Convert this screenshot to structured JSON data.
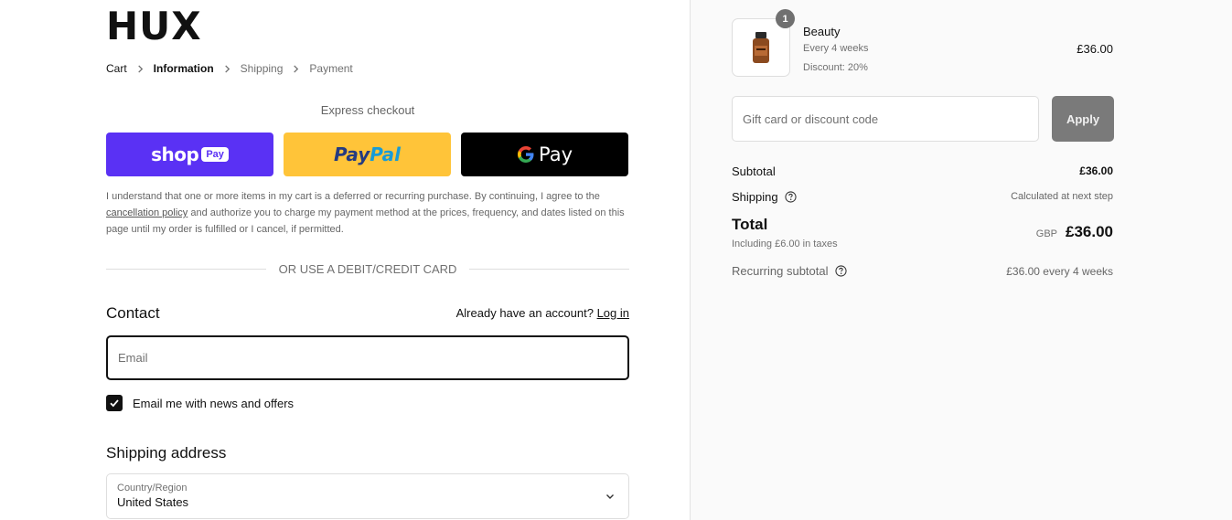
{
  "brand": {
    "logo_text": "HUX"
  },
  "breadcrumb": [
    {
      "label": "Cart",
      "state": "link"
    },
    {
      "label": "Information",
      "state": "current"
    },
    {
      "label": "Shipping",
      "state": "pending"
    },
    {
      "label": "Payment",
      "state": "pending"
    }
  ],
  "express": {
    "title": "Express checkout",
    "shop_word": "shop",
    "shop_pay": "Pay",
    "paypal_part1": "Pay",
    "paypal_part2": "Pal",
    "gpay_word": "Pay"
  },
  "disclaimer": {
    "before": "I understand that one or more items in my cart is a deferred or recurring purchase. By continuing, I agree to the ",
    "link": "cancellation policy",
    "after": " and authorize you to charge my payment method at the prices, frequency, and dates listed on this page until my order is fulfilled or I cancel, if permitted."
  },
  "divider_text": "OR USE A DEBIT/CREDIT CARD",
  "contact": {
    "heading": "Contact",
    "account_prompt": "Already have an account?",
    "login_label": "Log in",
    "email_placeholder": "Email",
    "newsletter_label": "Email me with news and offers",
    "newsletter_checked": true
  },
  "shipping_address": {
    "heading": "Shipping address",
    "country_label": "Country/Region",
    "country_value": "United States"
  },
  "order": {
    "item": {
      "quantity": "1",
      "name": "Beauty",
      "frequency": "Every 4 weeks",
      "discount": "Discount: 20%",
      "price": "£36.00"
    },
    "discount_placeholder": "Gift card or discount code",
    "apply_label": "Apply",
    "subtotal_label": "Subtotal",
    "subtotal_value": "£36.00",
    "shipping_label": "Shipping",
    "shipping_value": "Calculated at next step",
    "total_label": "Total",
    "taxes_note": "Including £6.00 in taxes",
    "currency": "GBP",
    "total_value": "£36.00",
    "recurring_label": "Recurring subtotal",
    "recurring_value": "£36.00 every 4 weeks"
  },
  "colors": {
    "shop_purple": "#5a31f4",
    "paypal_yellow": "#ffc439",
    "paypal_dark_blue": "#253b80",
    "paypal_light_blue": "#179bd7",
    "apply_gray": "#7a7a7a"
  },
  "icons": {
    "breadcrumb_separator": "chevron-right-icon",
    "checkbox": "checkmark-icon",
    "select": "chevron-down-icon",
    "help": "question-circle-icon",
    "google": "google-g-icon"
  }
}
